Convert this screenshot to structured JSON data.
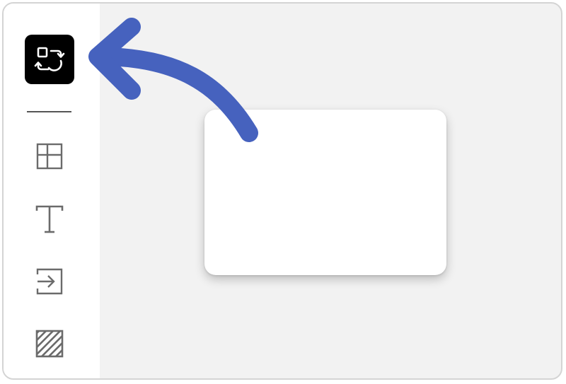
{
  "colors": {
    "accent_arrow": "#4662BE",
    "active_tool_bg": "#000000",
    "icon_stroke": "#6b6b6b",
    "canvas_bg": "#f2f2f2",
    "sidebar_bg": "#ffffff",
    "card_bg": "#ffffff"
  },
  "sidebar": {
    "tools": [
      {
        "icon": "swap-component-icon",
        "active": true
      },
      {
        "icon": "layout-grid-icon",
        "active": false
      },
      {
        "icon": "text-tool-icon",
        "active": false
      },
      {
        "icon": "insert-arrow-icon",
        "active": false
      },
      {
        "icon": "hatch-pattern-icon",
        "active": false
      }
    ]
  },
  "canvas": {
    "selected_element": "card",
    "annotation": "curved-arrow-pointing-to-active-tool"
  }
}
